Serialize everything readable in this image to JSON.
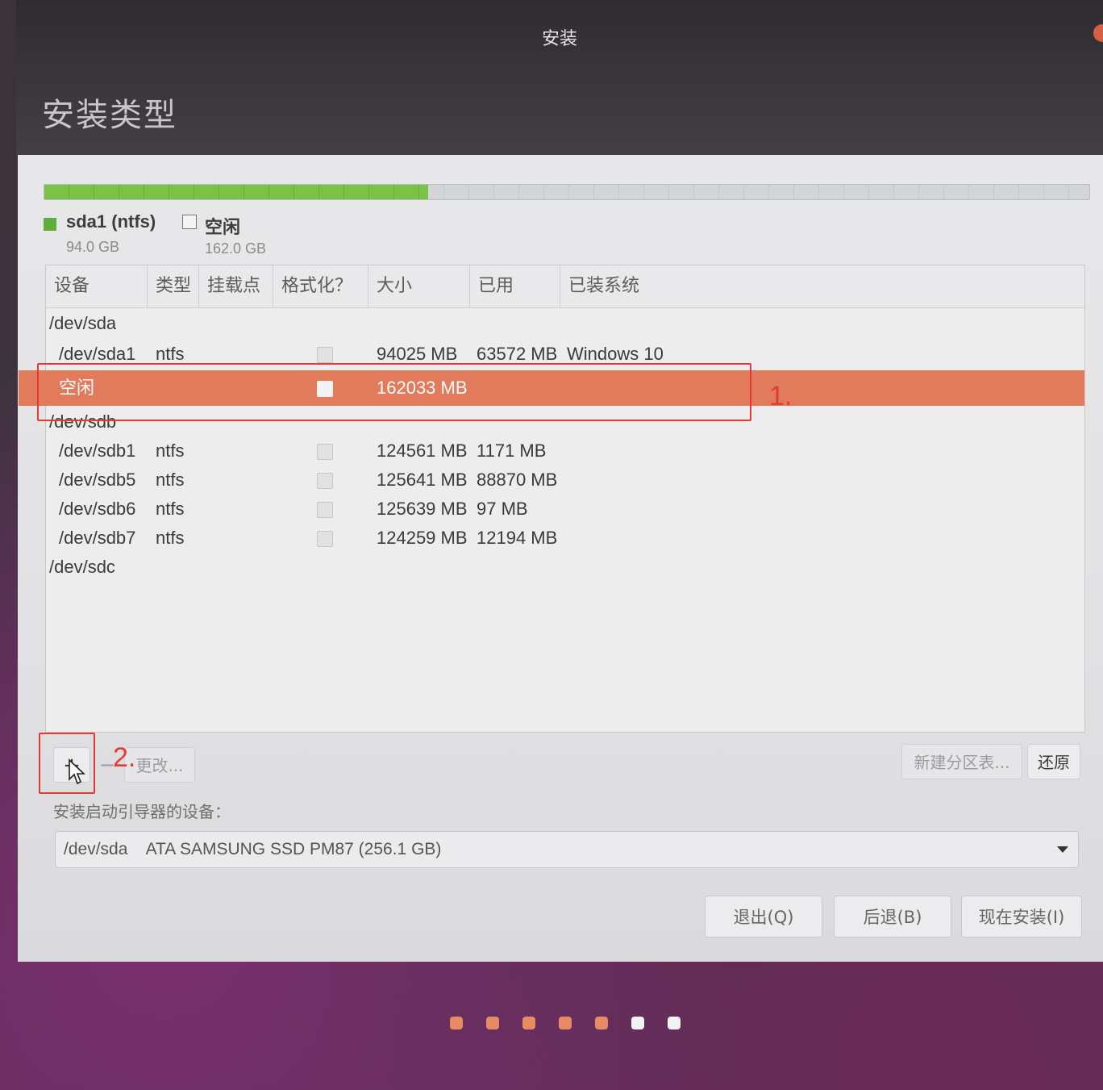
{
  "window": {
    "title": "安装"
  },
  "page": {
    "title": "安装类型"
  },
  "disk_usage": {
    "used_fraction": 0.367,
    "used_color": "#7bc246",
    "free_color": "#d2d5da",
    "legend": [
      {
        "name": "sda1 (ntfs)",
        "size": "94.0 GB",
        "color": "#5fae3a"
      },
      {
        "name": "空闲",
        "size": "162.0 GB",
        "color": "#f4f4f4"
      }
    ]
  },
  "table": {
    "headers": [
      "设备",
      "类型",
      "挂载点",
      "格式化？",
      "大小",
      "已用",
      "已装系统"
    ],
    "rows": [
      {
        "device": "/dev/sda",
        "type": "",
        "mount": "",
        "size": "",
        "used": "",
        "system": "",
        "indent": false,
        "checkbox": false
      },
      {
        "device": "/dev/sda1",
        "type": "ntfs",
        "mount": "",
        "size": "94025 MB",
        "used": "63572 MB",
        "system": "Windows 10",
        "indent": true,
        "checkbox": true
      },
      {
        "device": "空闲",
        "type": "",
        "mount": "",
        "size": "162033 MB",
        "used": "",
        "system": "",
        "indent": true,
        "checkbox": true,
        "selected": true
      },
      {
        "device": "/dev/sdb",
        "type": "",
        "mount": "",
        "size": "",
        "used": "",
        "system": "",
        "indent": false,
        "checkbox": false
      },
      {
        "device": "/dev/sdb1",
        "type": "ntfs",
        "mount": "",
        "size": "124561 MB",
        "used": "1171 MB",
        "system": "",
        "indent": true,
        "checkbox": true
      },
      {
        "device": "/dev/sdb5",
        "type": "ntfs",
        "mount": "",
        "size": "125641 MB",
        "used": "88870 MB",
        "system": "",
        "indent": true,
        "checkbox": true
      },
      {
        "device": "/dev/sdb6",
        "type": "ntfs",
        "mount": "",
        "size": "125639 MB",
        "used": "97 MB",
        "system": "",
        "indent": true,
        "checkbox": true
      },
      {
        "device": "/dev/sdb7",
        "type": "ntfs",
        "mount": "",
        "size": "124259 MB",
        "used": "12194 MB",
        "system": "",
        "indent": true,
        "checkbox": true
      },
      {
        "device": "/dev/sdc",
        "type": "",
        "mount": "",
        "size": "",
        "used": "",
        "system": "",
        "indent": false,
        "checkbox": false
      }
    ]
  },
  "toolbar": {
    "add_label": "+",
    "remove_label": "−",
    "change_label": "更改...",
    "new_table_label": "新建分区表...",
    "revert_label": "还原"
  },
  "bootloader": {
    "label": "安装启动引导器的设备：",
    "selected": "/dev/sda    ATA SAMSUNG SSD PM87 (256.1 GB)"
  },
  "nav": {
    "quit_label": "退出(Q)",
    "back_label": "后退(B)",
    "install_label": "现在安装(I)"
  },
  "annotations": [
    "1.",
    "2."
  ],
  "progress": {
    "total": 7,
    "completed": 5
  },
  "colors": {
    "accent": "#e27a5c",
    "annotation": "#e53935"
  }
}
